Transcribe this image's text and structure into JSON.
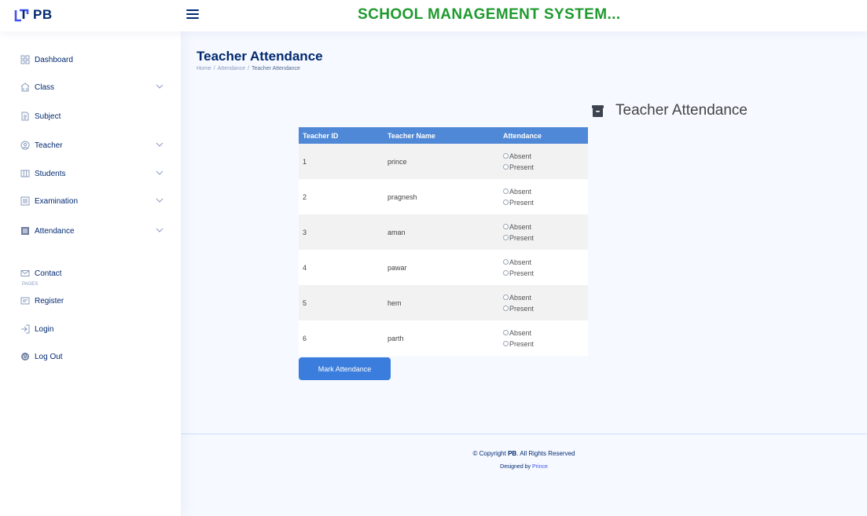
{
  "header": {
    "logo_text": "PB",
    "title": "SCHOOL MANAGEMENT SYSTEM..."
  },
  "sidebar": {
    "items": [
      {
        "label": "Dashboard",
        "icon": "grid-icon",
        "has_chevron": false
      },
      {
        "label": "Class",
        "icon": "building-icon",
        "has_chevron": true
      },
      {
        "label": "Subject",
        "icon": "document-icon",
        "has_chevron": false
      },
      {
        "label": "Teacher",
        "icon": "person-icon",
        "has_chevron": true
      },
      {
        "label": "Students",
        "icon": "columns-icon",
        "has_chevron": true
      },
      {
        "label": "Examination",
        "icon": "list-icon",
        "has_chevron": true
      },
      {
        "label": "Attendance",
        "icon": "bar-chart-icon",
        "has_chevron": true
      },
      {
        "label": "Contact",
        "icon": "envelope-icon",
        "has_chevron": false
      },
      {
        "label": "Register",
        "icon": "card-icon",
        "has_chevron": false
      },
      {
        "label": "Login",
        "icon": "login-icon",
        "has_chevron": false
      },
      {
        "label": "Log Out",
        "icon": "power-icon",
        "has_chevron": false
      }
    ],
    "section_heading": "Pages"
  },
  "page": {
    "title": "Teacher Attendance",
    "breadcrumb": [
      "Home",
      "Attendance",
      "Teacher Attendance"
    ],
    "section_heading": "Teacher Attendance"
  },
  "table": {
    "headers": [
      "Teacher ID",
      "Teacher Name",
      "Attendance"
    ],
    "options": [
      "Absent",
      "Present"
    ],
    "rows": [
      {
        "id": "1",
        "name": "prince"
      },
      {
        "id": "2",
        "name": "pragnesh"
      },
      {
        "id": "3",
        "name": "aman"
      },
      {
        "id": "4",
        "name": "pawar"
      },
      {
        "id": "5",
        "name": "hem"
      },
      {
        "id": "6",
        "name": "parth"
      }
    ]
  },
  "actions": {
    "mark_label": "Mark Attendance"
  },
  "footer": {
    "copyright_prefix": "© Copyright",
    "brand": "PB",
    "copyright_suffix": ". All Rights Reserved",
    "designed_prefix": "Designed by",
    "designer": "Prince"
  },
  "colors": {
    "title_green": "#1f9a2e",
    "table_header": "#4e88d6",
    "button": "#3b7ddd",
    "nav_text": "#012970"
  }
}
